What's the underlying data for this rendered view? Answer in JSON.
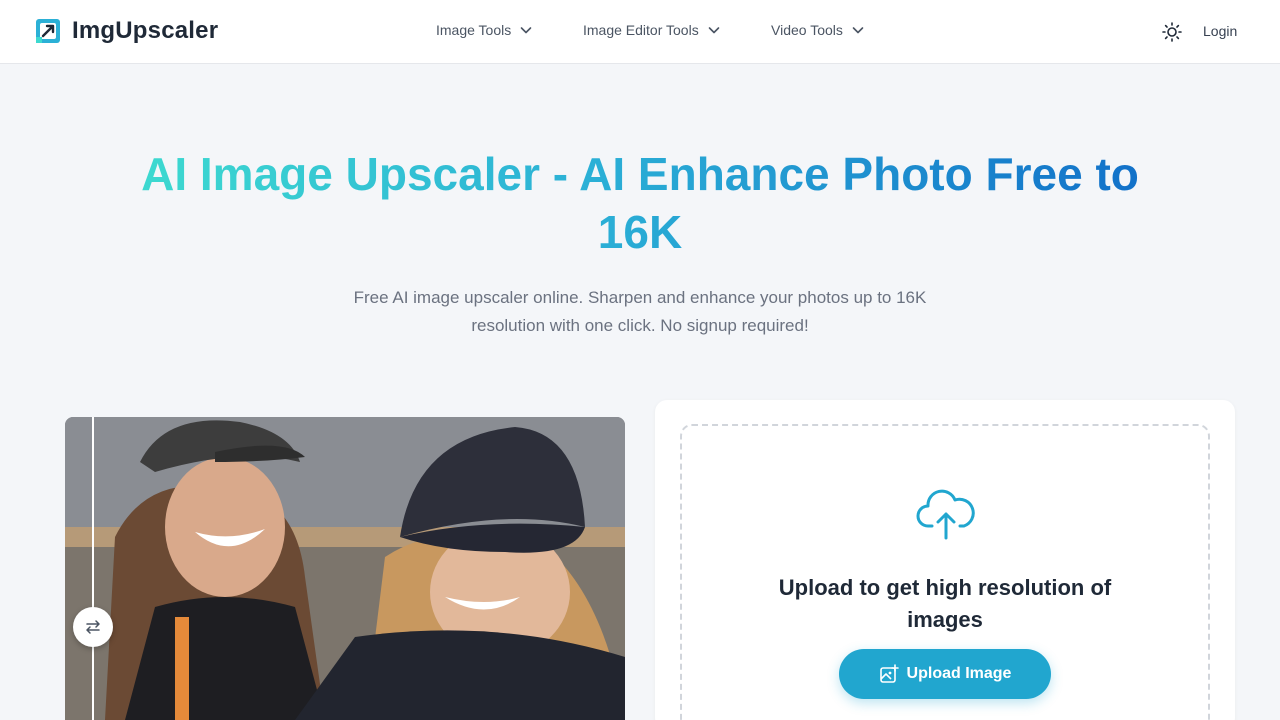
{
  "brand": {
    "name": "ImgUpscaler"
  },
  "nav": {
    "items": [
      {
        "label": "Image Tools"
      },
      {
        "label": "Image Editor Tools"
      },
      {
        "label": "Video Tools"
      }
    ],
    "login_label": "Login"
  },
  "hero": {
    "title": "AI Image Upscaler - AI Enhance Photo Free to 16K",
    "subtitle": "Free AI image upscaler online. Sharpen and enhance your photos up to 16K resolution with one click. No signup required!"
  },
  "upload": {
    "title": "Upload to get high resolution of images",
    "button_label": "Upload Image"
  },
  "icons": {
    "logo": "upscale-logo-icon",
    "chevron": "chevron-down-icon",
    "theme": "sun-icon",
    "cloud": "cloud-upload-icon",
    "compare_handle": "swap-arrows-icon",
    "upload_button": "image-plus-icon"
  },
  "colors": {
    "accent": "#21a6cf",
    "title_gradient_start": "#3dd9d0",
    "title_gradient_end": "#1271c9"
  }
}
